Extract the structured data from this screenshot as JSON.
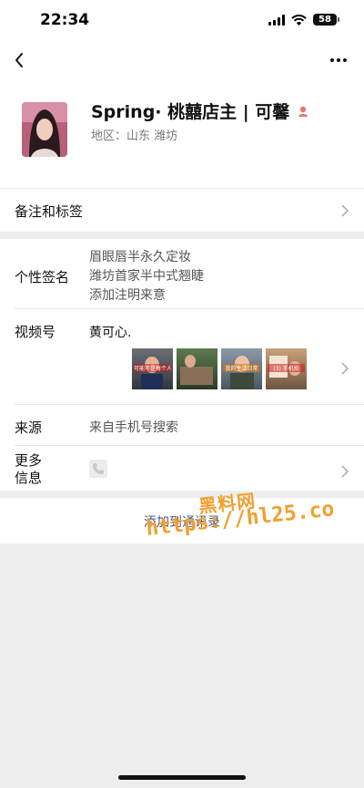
{
  "status": {
    "time": "22:34",
    "battery": "58"
  },
  "profile": {
    "name": "Spring· 桃囍店主 | 可馨",
    "region": "地区：山东 潍坊"
  },
  "rows": {
    "remark_label": "备注和标签",
    "signature_label": "个性签名",
    "signature_lines": [
      "眉眼唇半永久定妆",
      "潍坊首家半中式翘睫",
      "添加注明来意"
    ],
    "channels_label": "视频号",
    "channels_name": "黄可心.",
    "channels_thumbs": [
      "可能不是每个人...",
      "",
      "我的生活日常",
      "(3) 手机拍"
    ],
    "source_label": "来源",
    "source_value": "来自手机号搜索",
    "more_label_1": "更多",
    "more_label_2": "信息"
  },
  "actions": {
    "add_contact": "添加到通讯录"
  },
  "watermark": {
    "cn": "黑料网",
    "url": "https://hl25.co"
  },
  "colors": {
    "link": "#4a5a80",
    "watermark": "#f0a030",
    "gender_badge": "#e8756f"
  }
}
